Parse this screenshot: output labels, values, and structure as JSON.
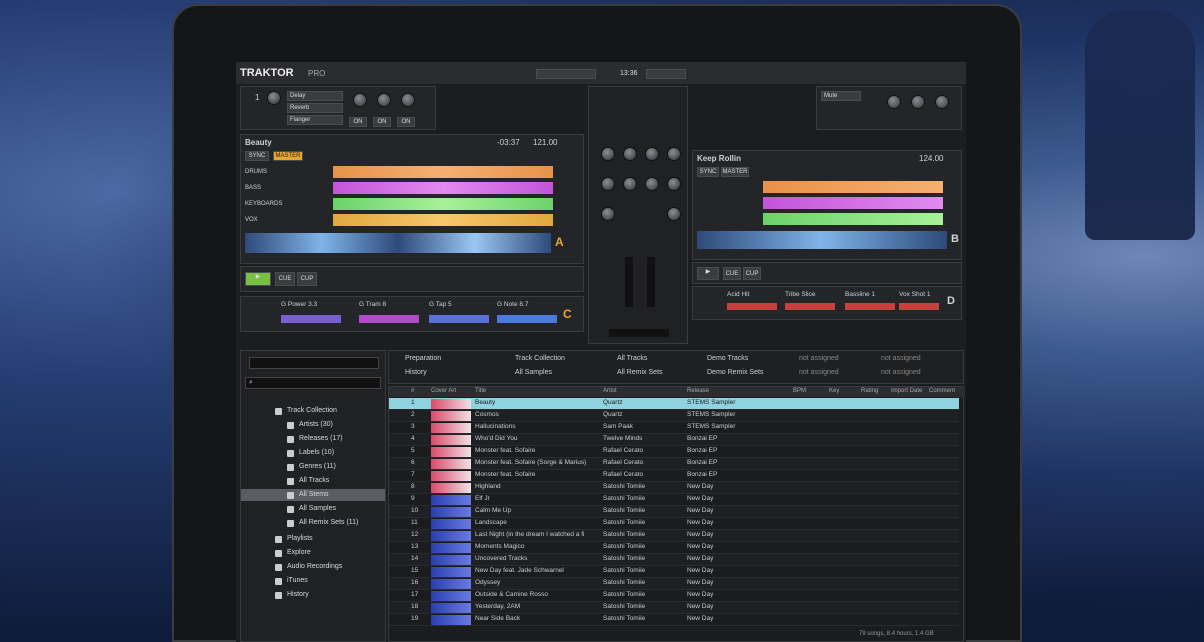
{
  "app": {
    "logo": "TRAKTOR",
    "logo_suffix": "PRO",
    "clock": "13:36"
  },
  "fx": {
    "unit": "1",
    "effects": [
      "Delay",
      "Reverb",
      "Flanger"
    ],
    "on": "ON",
    "right_effect": "Mute"
  },
  "deck_a": {
    "title": "Beauty",
    "time": "-03:37",
    "bpm": "121.00",
    "letter": "A",
    "sync": "SYNC",
    "master": "MASTER",
    "cue": "CUE",
    "cup": "CUP",
    "slots": [
      "DRUMS",
      "BASS",
      "KEYBOARDS",
      "VOX"
    ]
  },
  "deck_b": {
    "title": "Keep Rollin",
    "time": "",
    "bpm": "124.00",
    "letter": "B",
    "sync": "SYNC",
    "master": "MASTER",
    "cue": "CUE",
    "cup": "CUP"
  },
  "deck_c": {
    "letter": "C",
    "cells": [
      "G Power 3.3",
      "G Tram 8",
      "G Tap 5",
      "G Note 8.7"
    ]
  },
  "deck_d": {
    "letter": "D",
    "cells": [
      "Acid Hit",
      "Tribe Slice",
      "Bassline 1",
      "Vox Shot 1"
    ]
  },
  "browser": {
    "favorites": [
      "Preparation",
      "History",
      "Track Collection",
      "All Samples",
      "All Tracks",
      "All Remix Sets",
      "Demo Tracks",
      "Demo Remix Sets",
      "not assigned",
      "not assigned",
      "not assigned",
      "not assigned"
    ],
    "tree": [
      "Track Collection",
      "Artists (30)",
      "Releases (17)",
      "Labels (10)",
      "Genres (11)",
      "All Tracks",
      "All Stems",
      "All Samples",
      "All Remix Sets (11)",
      "Playlists",
      "Explore",
      "Audio Recordings",
      "iTunes",
      "History"
    ],
    "columns": [
      "#",
      "Cover Art",
      "Title",
      "Artist",
      "Release",
      "BPM",
      "Key",
      "Rating",
      "Import Date",
      "Comment"
    ],
    "tracks": [
      {
        "n": "1",
        "title": "Beauty",
        "artist": "Quartz",
        "release": "STEMS Sampler"
      },
      {
        "n": "2",
        "title": "Cosmos",
        "artist": "Quartz",
        "release": "STEMS Sampler"
      },
      {
        "n": "3",
        "title": "Hallucinations",
        "artist": "Sam Paak",
        "release": "STEMS Sampler"
      },
      {
        "n": "4",
        "title": "Who'd Did You",
        "artist": "Twelve Minds",
        "release": "Bonzai EP"
      },
      {
        "n": "5",
        "title": "Monster feat. Sofaire",
        "artist": "Rafael Cerato",
        "release": "Bonzai EP"
      },
      {
        "n": "6",
        "title": "Monster feat. Sofaire (Sorge & Marius)",
        "artist": "Rafael Cerato",
        "release": "Bonzai EP"
      },
      {
        "n": "7",
        "title": "Monster feat. Sofaire",
        "artist": "Rafael Cerato",
        "release": "Bonzai EP"
      },
      {
        "n": "8",
        "title": "Highland",
        "artist": "Satoshi Tomiie",
        "release": "New Day"
      },
      {
        "n": "9",
        "title": "Elf Jr",
        "artist": "Satoshi Tomiie",
        "release": "New Day"
      },
      {
        "n": "10",
        "title": "Calm Me Up",
        "artist": "Satoshi Tomiie",
        "release": "New Day"
      },
      {
        "n": "11",
        "title": "Landscape",
        "artist": "Satoshi Tomiie",
        "release": "New Day"
      },
      {
        "n": "12",
        "title": "Last Night (in the dream I watched a fi",
        "artist": "Satoshi Tomiie",
        "release": "New Day"
      },
      {
        "n": "13",
        "title": "Moments Magico",
        "artist": "Satoshi Tomiie",
        "release": "New Day"
      },
      {
        "n": "14",
        "title": "Uncovered Tracks",
        "artist": "Satoshi Tomiie",
        "release": "New Day"
      },
      {
        "n": "15",
        "title": "New Day feat. Jade Schwarnel",
        "artist": "Satoshi Tomiie",
        "release": "New Day"
      },
      {
        "n": "16",
        "title": "Odyssey",
        "artist": "Satoshi Tomiie",
        "release": "New Day"
      },
      {
        "n": "17",
        "title": "Outside & Camine Rosso",
        "artist": "Satoshi Tomiie",
        "release": "New Day"
      },
      {
        "n": "18",
        "title": "Yesterday, 2AM",
        "artist": "Satoshi Tomiie",
        "release": "New Day"
      },
      {
        "n": "19",
        "title": "Near Side Back",
        "artist": "Satoshi Tomiie",
        "release": "New Day"
      }
    ],
    "status": "79 songs, 8.4 hours, 1.4 GB"
  }
}
